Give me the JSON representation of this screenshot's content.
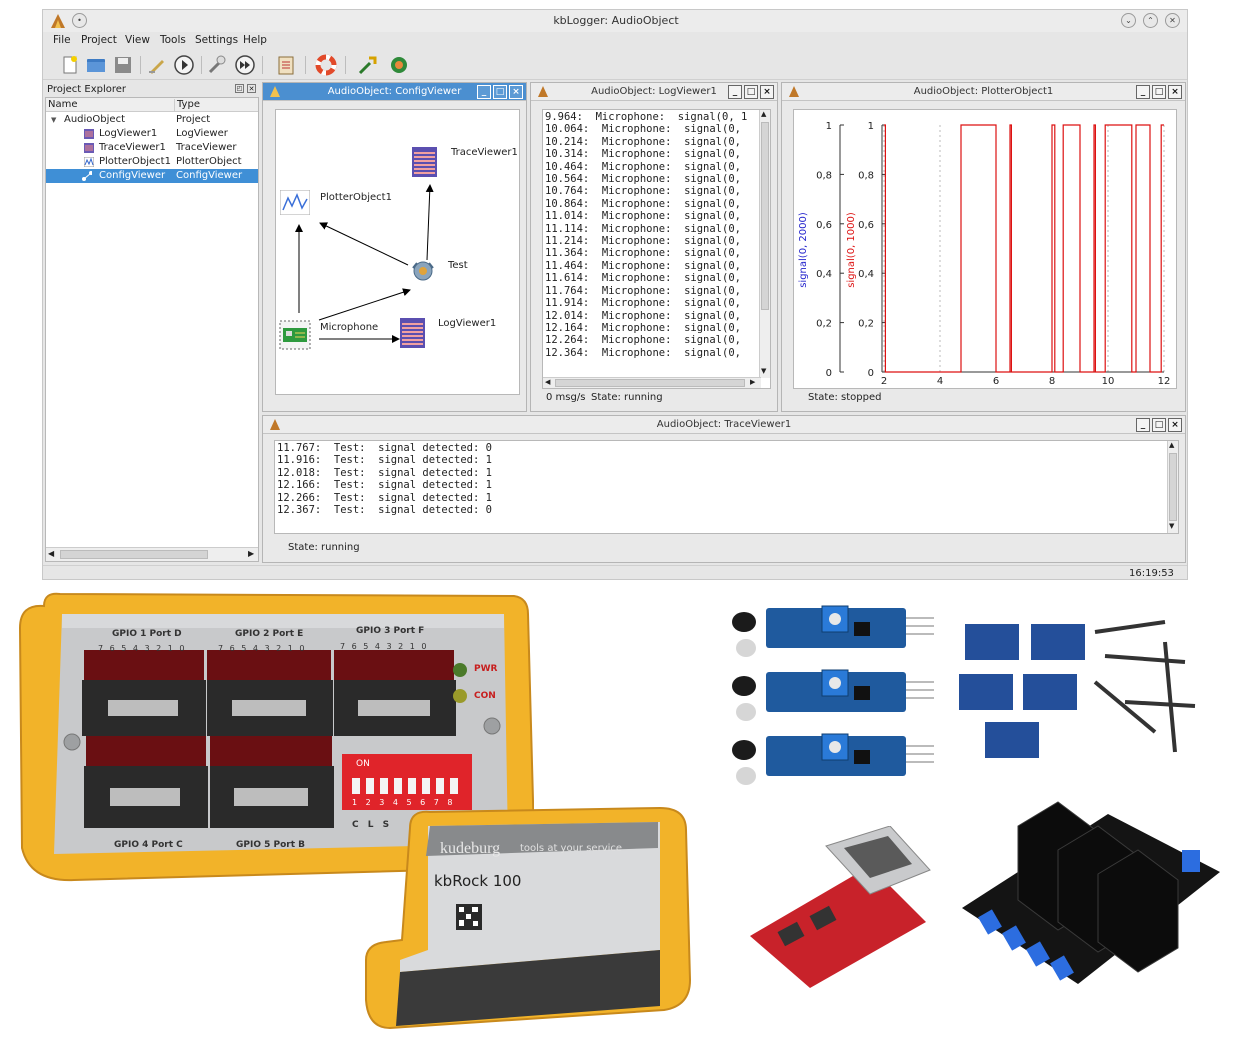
{
  "window": {
    "title": "kbLogger: AudioObject",
    "clock": "16:19:53"
  },
  "menu": [
    "File",
    "Project",
    "View",
    "Tools",
    "Settings",
    "Help"
  ],
  "toolbar_icons": [
    "new-file-icon",
    "open-folder-icon",
    "save-icon",
    "edit-icon",
    "play-icon",
    "tools-icon",
    "fast-forward-icon",
    "clipboard-icon",
    "lifebuoy-icon",
    "build-icon",
    "network-icon"
  ],
  "project_explorer": {
    "title": "Project Explorer",
    "columns": [
      "Name",
      "Type"
    ],
    "rows": [
      {
        "name": "AudioObject",
        "type": "Project"
      },
      {
        "name": "LogViewer1",
        "type": "LogViewer"
      },
      {
        "name": "TraceViewer1",
        "type": "TraceViewer"
      },
      {
        "name": "PlotterObject1",
        "type": "PlotterObject"
      },
      {
        "name": "ConfigViewer",
        "type": "ConfigViewer"
      }
    ]
  },
  "config_viewer": {
    "title": "AudioObject: ConfigViewer",
    "nodes": {
      "trace": "TraceViewer1",
      "plotter": "PlotterObject1",
      "test": "Test",
      "mic": "Microphone",
      "log": "LogViewer1"
    }
  },
  "log_viewer": {
    "title": "AudioObject: LogViewer1",
    "lines": [
      "9.964:  Microphone:  signal(0, 1",
      "10.064:  Microphone:  signal(0,",
      "10.214:  Microphone:  signal(0,",
      "10.314:  Microphone:  signal(0,",
      "10.464:  Microphone:  signal(0,",
      "10.564:  Microphone:  signal(0,",
      "10.764:  Microphone:  signal(0,",
      "10.864:  Microphone:  signal(0,",
      "11.014:  Microphone:  signal(0,",
      "11.114:  Microphone:  signal(0,",
      "11.214:  Microphone:  signal(0,",
      "11.364:  Microphone:  signal(0,",
      "11.464:  Microphone:  signal(0,",
      "11.614:  Microphone:  signal(0,",
      "11.764:  Microphone:  signal(0,",
      "11.914:  Microphone:  signal(0,",
      "12.014:  Microphone:  signal(0,",
      "12.164:  Microphone:  signal(0,",
      "12.264:  Microphone:  signal(0,",
      "12.364:  Microphone:  signal(0,"
    ],
    "rate": "0 msg/s",
    "state": "State: running"
  },
  "plotter": {
    "title": "AudioObject: PlotterObject1",
    "state": "State: stopped",
    "colors": {
      "blue": "#2222cc",
      "red": "#dd1111"
    },
    "chart_data": {
      "type": "line",
      "xlim": [
        2,
        12
      ],
      "xticks": [
        "2",
        "4",
        "6",
        "8",
        "10",
        "12"
      ],
      "ylim": [
        0,
        1
      ],
      "yticks": [
        "0",
        "0,2",
        "0,4",
        "0,6",
        "0,8",
        "1"
      ],
      "y_axes": [
        {
          "label": "signal(0, 2000)",
          "color": "#2222cc"
        },
        {
          "label": "signal(0, 1000)",
          "color": "#dd1111"
        }
      ],
      "series": [
        {
          "color": "#dd1111",
          "x": [
            2.0,
            2.05,
            2.05,
            4.75,
            4.75,
            6.0,
            6.0,
            6.5,
            6.5,
            6.55,
            6.55,
            7.0,
            7.0,
            8.0,
            8.0,
            8.1,
            8.1,
            8.4,
            8.4,
            9.0,
            9.0,
            9.5,
            9.5,
            9.55,
            9.55,
            9.9,
            9.9,
            10.85,
            10.85,
            11.0,
            11.0,
            11.5,
            11.5,
            11.9,
            11.9,
            12.0
          ],
          "y": [
            1,
            1,
            0,
            0,
            1,
            1,
            0,
            0,
            1,
            1,
            0,
            0,
            0,
            0,
            1,
            1,
            0,
            0,
            1,
            1,
            0,
            0,
            1,
            1,
            0,
            0,
            1,
            1,
            0,
            0,
            1,
            1,
            0,
            0,
            1,
            1
          ]
        }
      ]
    }
  },
  "trace_viewer": {
    "title": "AudioObject: TraceViewer1",
    "lines": [
      "11.767:  Test:  signal detected: 0",
      "11.916:  Test:  signal detected: 1",
      "12.018:  Test:  signal detected: 1",
      "12.166:  Test:  signal detected: 1",
      "12.266:  Test:  signal detected: 1",
      "12.367:  Test:  signal detected: 0"
    ],
    "state": "State: running"
  },
  "photos": {
    "gpio_box": {
      "ports": [
        "GPIO 1  Port D",
        "GPIO 2  Port E",
        "GPIO 3  Port F",
        "GPIO 4  Port C",
        "GPIO 5  Port B"
      ],
      "bits": "7 6 5 4 3 2 1 0",
      "leds": [
        "PWR",
        "CON"
      ],
      "dip_label": "ON",
      "dip_numbers": "1 2 3 4 5 6 7 8",
      "cls": "C L S"
    },
    "kbrock": {
      "brand": "kudeburg",
      "tagline": "tools at your service",
      "model": "kbRock 100"
    }
  }
}
